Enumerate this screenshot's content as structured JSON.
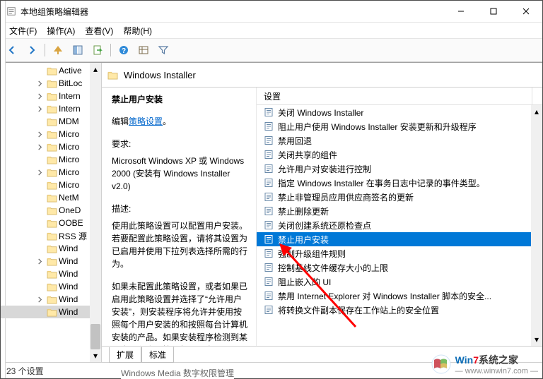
{
  "window": {
    "title": "本地组策略编辑器"
  },
  "menu": {
    "file": "文件(F)",
    "action": "操作(A)",
    "view": "查看(V)",
    "help": "帮助(H)"
  },
  "tree": {
    "items": [
      {
        "label": "Active",
        "arrow": false
      },
      {
        "label": "BitLoc",
        "arrow": true
      },
      {
        "label": "Intern",
        "arrow": true
      },
      {
        "label": "Intern",
        "arrow": true
      },
      {
        "label": "MDM",
        "arrow": false
      },
      {
        "label": "Micro",
        "arrow": true
      },
      {
        "label": "Micro",
        "arrow": true
      },
      {
        "label": "Micro",
        "arrow": false
      },
      {
        "label": "Micro",
        "arrow": true
      },
      {
        "label": "Micro",
        "arrow": false
      },
      {
        "label": "NetM",
        "arrow": false
      },
      {
        "label": "OneD",
        "arrow": false
      },
      {
        "label": "OOBE",
        "arrow": false
      },
      {
        "label": "RSS 源",
        "arrow": false
      },
      {
        "label": "Wind",
        "arrow": false
      },
      {
        "label": "Wind",
        "arrow": true
      },
      {
        "label": "Wind",
        "arrow": false
      },
      {
        "label": "Wind",
        "arrow": false
      },
      {
        "label": "Wind",
        "arrow": true
      },
      {
        "label": "Wind",
        "arrow": false,
        "sel": true
      }
    ]
  },
  "path": {
    "label": "Windows Installer"
  },
  "desc": {
    "title": "禁止用户安装",
    "edit_prefix": "编辑",
    "edit_link": "策略设置",
    "req_label": "要求:",
    "req_body": "Microsoft Windows XP 或 Windows 2000 (安装有 Windows Installer v2.0)",
    "desc_label": "描述:",
    "desc_p1": "使用此策略设置可以配置用户安装。若要配置此策略设置，请将其设置为已启用并使用下拉列表选择所需的行为。",
    "desc_p2": "如果未配置此策略设置，或者如果已启用此策略设置并选择了“允许用户安装”，则安装程序将允许并使用按照每个用户安装的和按照每台计算机安装的产品。如果安装程序检测到某个应用程序是按照每个用户"
  },
  "list": {
    "header": "设置",
    "items": [
      "关闭 Windows Installer",
      "阻止用户使用 Windows Installer 安装更新和升级程序",
      "禁用回退",
      "关闭共享的组件",
      "允许用户对安装进行控制",
      "指定 Windows Installer 在事务日志中记录的事件类型。",
      "禁止非管理员应用供应商签名的更新",
      "禁止删除更新",
      "关闭创建系统还原检查点",
      "禁止用户安装",
      "强制升级组件规则",
      "控制基线文件缓存大小的上限",
      "阻止嵌入的 UI",
      "禁用 Internet Explorer 对 Windows Installer 脚本的安全...",
      "将转换文件副本保存在工作站上的安全位置"
    ],
    "selected": 9
  },
  "tabs": {
    "ext": "扩展",
    "std": "标准"
  },
  "status": {
    "text": "23 个设置"
  },
  "hidden_row": "Windows Media 数字权限管理"
}
